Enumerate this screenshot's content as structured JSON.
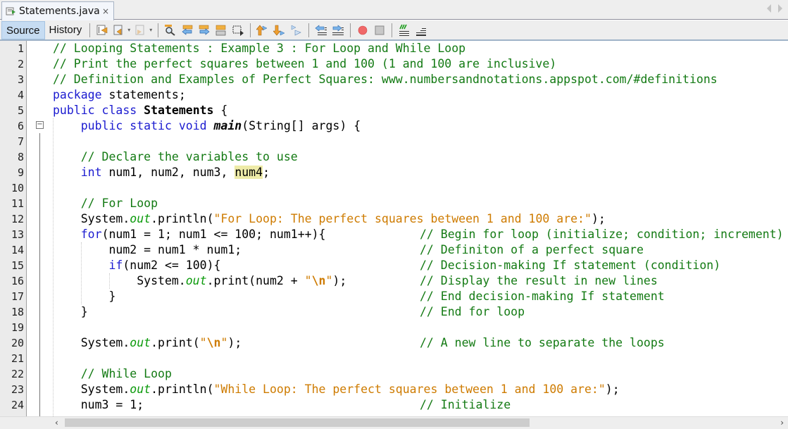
{
  "tab": {
    "title": "Statements.java",
    "close_glyph": "×",
    "file_icon": "java-file-icon"
  },
  "toolbar": {
    "source_label": "Source",
    "history_label": "History",
    "icons": [
      "last-edit-icon",
      "back-icon",
      "forward-icon",
      "find-icon",
      "find-previous-icon",
      "find-next-icon",
      "toggle-highlight-icon",
      "select-icon",
      "previous-bookmark-icon",
      "next-bookmark-icon",
      "toggle-bookmark-icon",
      "shift-left-icon",
      "shift-right-icon",
      "record-macro-icon",
      "stop-macro-icon",
      "comment-icon",
      "uncomment-icon"
    ]
  },
  "editor": {
    "highlighted_token": "num4",
    "lines": [
      {
        "n": "1",
        "segments": [
          {
            "t": "// Looping Statements : Example 3 : For Loop and While Loop",
            "c": "cmt"
          }
        ]
      },
      {
        "n": "2",
        "segments": [
          {
            "t": "// Print the perfect squares between 1 and 100 (1 and 100 are inclusive)",
            "c": "cmt"
          }
        ]
      },
      {
        "n": "3",
        "segments": [
          {
            "t": "// Definition and Examples of Perfect Squares: www.numbersandnotations.appspot.com/#definitions",
            "c": "cmt"
          }
        ]
      },
      {
        "n": "4",
        "segments": [
          {
            "t": "package",
            "c": "kw"
          },
          {
            "t": " statements;",
            "c": ""
          }
        ]
      },
      {
        "n": "5",
        "segments": [
          {
            "t": "public class",
            "c": "kw"
          },
          {
            "t": " ",
            "c": ""
          },
          {
            "t": "Statements",
            "c": "bold"
          },
          {
            "t": " {",
            "c": ""
          }
        ]
      },
      {
        "n": "6",
        "segments": [
          {
            "t": "    ",
            "c": ""
          },
          {
            "t": "public static void",
            "c": "kw"
          },
          {
            "t": " ",
            "c": ""
          },
          {
            "t": "main",
            "c": "meth"
          },
          {
            "t": "(String[] args) {",
            "c": ""
          }
        ]
      },
      {
        "n": "7",
        "segments": []
      },
      {
        "n": "8",
        "segments": [
          {
            "t": "    ",
            "c": ""
          },
          {
            "t": "// Declare the variables to use",
            "c": "cmt"
          }
        ]
      },
      {
        "n": "9",
        "segments": [
          {
            "t": "    ",
            "c": ""
          },
          {
            "t": "int",
            "c": "kw"
          },
          {
            "t": " num1, num2, num3, ",
            "c": ""
          },
          {
            "t": "num4",
            "c": "hl"
          },
          {
            "t": ";",
            "c": ""
          }
        ]
      },
      {
        "n": "10",
        "segments": []
      },
      {
        "n": "11",
        "segments": [
          {
            "t": "    ",
            "c": ""
          },
          {
            "t": "// For Loop",
            "c": "cmt"
          }
        ]
      },
      {
        "n": "12",
        "segments": [
          {
            "t": "    System.",
            "c": ""
          },
          {
            "t": "out",
            "c": "fld"
          },
          {
            "t": ".println(",
            "c": ""
          },
          {
            "t": "\"For Loop: The perfect squares between 1 and 100 are:\"",
            "c": "str"
          },
          {
            "t": ");",
            "c": ""
          }
        ]
      },
      {
        "n": "13",
        "segments": [
          {
            "t": "    ",
            "c": ""
          },
          {
            "t": "for",
            "c": "kw"
          },
          {
            "t": "(num1 = 1; num1 <= 100; num1++){",
            "c": ""
          }
        ],
        "comment": "// Begin for loop (initialize; condition; increment)"
      },
      {
        "n": "14",
        "segments": [
          {
            "t": "        num2 = num1 * num1;",
            "c": ""
          }
        ],
        "comment": "// Definiton of a perfect square"
      },
      {
        "n": "15",
        "segments": [
          {
            "t": "        ",
            "c": ""
          },
          {
            "t": "if",
            "c": "kw"
          },
          {
            "t": "(num2 <= 100){",
            "c": ""
          }
        ],
        "comment": "// Decision-making If statement (condition)"
      },
      {
        "n": "16",
        "segments": [
          {
            "t": "            System.",
            "c": ""
          },
          {
            "t": "out",
            "c": "fld"
          },
          {
            "t": ".print(num2 + ",
            "c": ""
          },
          {
            "t": "\"",
            "c": "str"
          },
          {
            "t": "\\n",
            "c": "esc"
          },
          {
            "t": "\"",
            "c": "str"
          },
          {
            "t": ");",
            "c": ""
          }
        ],
        "comment": "// Display the result in new lines"
      },
      {
        "n": "17",
        "segments": [
          {
            "t": "        }",
            "c": ""
          }
        ],
        "comment": "// End decision-making If statement"
      },
      {
        "n": "18",
        "segments": [
          {
            "t": "    }",
            "c": ""
          }
        ],
        "comment": "// End for loop"
      },
      {
        "n": "19",
        "segments": []
      },
      {
        "n": "20",
        "segments": [
          {
            "t": "    System.",
            "c": ""
          },
          {
            "t": "out",
            "c": "fld"
          },
          {
            "t": ".print(",
            "c": ""
          },
          {
            "t": "\"",
            "c": "str"
          },
          {
            "t": "\\n",
            "c": "esc"
          },
          {
            "t": "\"",
            "c": "str"
          },
          {
            "t": ");",
            "c": ""
          }
        ],
        "comment": "// A new line to separate the loops"
      },
      {
        "n": "21",
        "segments": []
      },
      {
        "n": "22",
        "segments": [
          {
            "t": "    ",
            "c": ""
          },
          {
            "t": "// While Loop",
            "c": "cmt"
          }
        ]
      },
      {
        "n": "23",
        "segments": [
          {
            "t": "    System.",
            "c": ""
          },
          {
            "t": "out",
            "c": "fld"
          },
          {
            "t": ".println(",
            "c": ""
          },
          {
            "t": "\"While Loop: The perfect squares between 1 and 100 are:\"",
            "c": "str"
          },
          {
            "t": ");",
            "c": ""
          }
        ]
      },
      {
        "n": "24",
        "segments": [
          {
            "t": "    num3 = 1;",
            "c": ""
          }
        ],
        "comment": "// Initialize"
      }
    ]
  },
  "scrollbar": {
    "left_arrow": "‹",
    "right_arrow": "›"
  },
  "colors": {
    "comment": "#137a13",
    "keyword": "#1b1bd0",
    "string": "#ce7b00",
    "field": "#0b9a0b",
    "highlight": "#eeeba8",
    "active_tab_bg": "#c6dcf2"
  }
}
